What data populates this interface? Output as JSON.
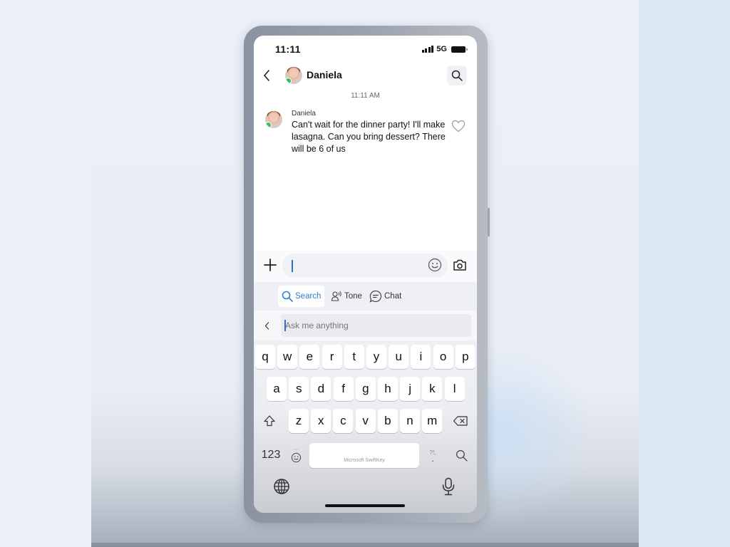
{
  "status_bar": {
    "time": "11:11",
    "network": "5G"
  },
  "header": {
    "contact_name": "Daniela"
  },
  "conversation": {
    "timestamp": "11:11 AM",
    "messages": [
      {
        "sender": "Daniela",
        "text": "Can't wait for the dinner party! I'll make lasagna. Can you bring dessert? There will be 6 of us"
      }
    ]
  },
  "compose": {
    "value": ""
  },
  "keyboard_toolbar": {
    "items": [
      {
        "label": "Search",
        "icon": "search-icon",
        "active": true
      },
      {
        "label": "Tone",
        "icon": "tone-icon",
        "active": false
      },
      {
        "label": "Chat",
        "icon": "chat-icon",
        "active": false
      }
    ]
  },
  "ask_input": {
    "placeholder": "Ask me anything",
    "value": ""
  },
  "keyboard": {
    "row1": [
      "q",
      "w",
      "e",
      "r",
      "t",
      "y",
      "u",
      "i",
      "o",
      "p"
    ],
    "row2": [
      "a",
      "s",
      "d",
      "f",
      "g",
      "h",
      "j",
      "k",
      "l"
    ],
    "row3": [
      "z",
      "x",
      "c",
      "v",
      "b",
      "n",
      "m"
    ],
    "numbers_label": "123",
    "punct_label": "?!,",
    "space_label": "Microsoft SwiftKey"
  },
  "colors": {
    "accent": "#2a7fd4",
    "presence": "#3fbf5a"
  }
}
